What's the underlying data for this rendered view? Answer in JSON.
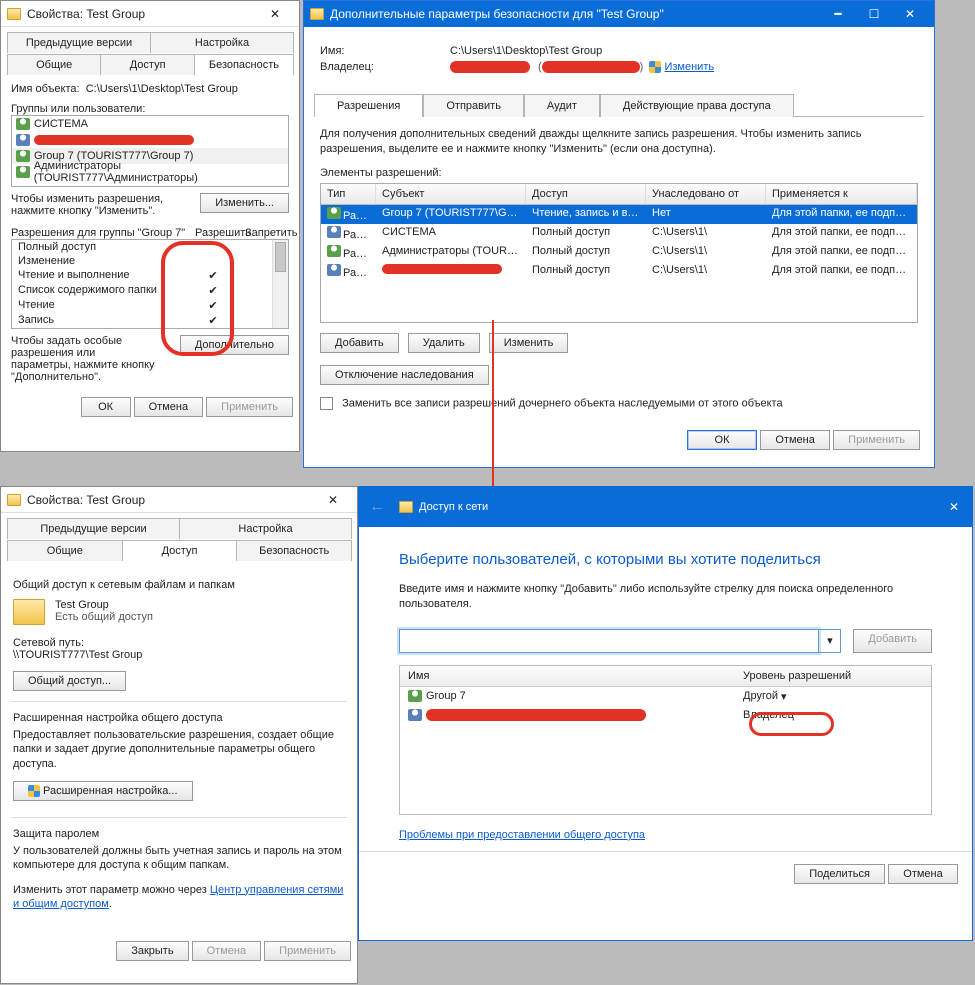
{
  "props1": {
    "title": "Свойства: Test Group",
    "tabs": {
      "prev": "Предыдущие версии",
      "cfg": "Настройка",
      "gen": "Общие",
      "share": "Доступ",
      "sec": "Безопасность"
    },
    "obj_label": "Имя объекта:",
    "obj_value": "C:\\Users\\1\\Desktop\\Test Group",
    "groups_label": "Группы или пользователи:",
    "groups": [
      {
        "name": "СИСТЕМА"
      },
      {
        "name": "redacted"
      },
      {
        "name": "Group 7 (TOURIST777\\Group 7)"
      },
      {
        "name": "Администраторы (TOURIST777\\Администраторы)"
      }
    ],
    "hint1a": "Чтобы изменить разрешения,",
    "hint1b": "нажмите кнопку \"Изменить\".",
    "edit": "Изменить...",
    "perm_for": "Разрешения для группы \"Group 7\"",
    "allow": "Разрешить",
    "deny": "Запретить",
    "perms": [
      {
        "n": "Полный доступ",
        "a": false
      },
      {
        "n": "Изменение",
        "a": false
      },
      {
        "n": "Чтение и выполнение",
        "a": true
      },
      {
        "n": "Список содержимого папки",
        "a": true
      },
      {
        "n": "Чтение",
        "a": true
      },
      {
        "n": "Запись",
        "a": true
      }
    ],
    "hint2a": "Чтобы задать особые разрешения или",
    "hint2b": "параметры, нажмите кнопку",
    "hint2c": "\"Дополнительно\".",
    "adv": "Дополнительно",
    "ok": "ОК",
    "cancel": "Отмена",
    "apply": "Применить"
  },
  "adv": {
    "title": "Дополнительные параметры безопасности для \"Test Group\"",
    "name_k": "Имя:",
    "name_v": "C:\\Users\\1\\Desktop\\Test Group",
    "owner_k": "Владелец:",
    "change": "Изменить",
    "tabs": {
      "perm": "Разрешения",
      "send": "Отправить",
      "audit": "Аудит",
      "eff": "Действующие права доступа"
    },
    "help": "Для получения дополнительных сведений дважды щелкните запись разрешения. Чтобы изменить запись разрешения, выделите ее и нажмите кнопку \"Изменить\" (если она доступна).",
    "elements": "Элементы разрешений:",
    "cols": {
      "type": "Тип",
      "subj": "Субъект",
      "acc": "Доступ",
      "inh": "Унаследовано от",
      "app": "Применяется к"
    },
    "rows": [
      {
        "t": "Разр...",
        "s": "Group 7 (TOURIST777\\Group 7)",
        "a": "Чтение, запись и вып...",
        "i": "Нет",
        "p": "Для этой папки, ее подпапок ..."
      },
      {
        "t": "Разр...",
        "s": "СИСТЕМА",
        "a": "Полный доступ",
        "i": "C:\\Users\\1\\",
        "p": "Для этой папки, ее подпапок ..."
      },
      {
        "t": "Разр...",
        "s": "Администраторы (TOURIST77...",
        "a": "Полный доступ",
        "i": "C:\\Users\\1\\",
        "p": "Для этой папки, ее подпапок ..."
      },
      {
        "t": "Разр...",
        "s": "redacted",
        "a": "Полный доступ",
        "i": "C:\\Users\\1\\",
        "p": "Для этой папки, ее подпапок ..."
      }
    ],
    "add": "Добавить",
    "del": "Удалить",
    "edit": "Изменить",
    "dis": "Отключение наследования",
    "chk": "Заменить все записи разрешений дочернего объекта наследуемыми от этого объекта",
    "ok": "ОК",
    "cancel": "Отмена",
    "apply": "Применить"
  },
  "props2": {
    "title": "Свойства: Test Group",
    "tabs": {
      "prev": "Предыдущие версии",
      "cfg": "Настройка",
      "gen": "Общие",
      "share": "Доступ",
      "sec": "Безопасность"
    },
    "g1_title": "Общий доступ к сетевым файлам и папкам",
    "foldername": "Test Group",
    "shared": "Есть общий доступ",
    "netpath_k": "Сетевой путь:",
    "netpath_v": "\\\\TOURIST777\\Test Group",
    "sharebtn": "Общий доступ...",
    "g2_title": "Расширенная настройка общего доступа",
    "g2_text": "Предоставляет пользовательские разрешения, создает общие папки и задает другие дополнительные параметры общего доступа.",
    "advshare": "Расширенная настройка...",
    "g3_title": "Защита паролем",
    "g3_text": "У пользователей должны быть учетная запись и пароль на этом компьютере для доступа к общим папкам.",
    "g3_text2": "Изменить этот параметр можно через ",
    "g3_link": "Центр управления сетями и общим доступом",
    "close": "Закрыть",
    "cancel": "Отмена",
    "apply": "Применить"
  },
  "net": {
    "breadcrumb": "Доступ к сети",
    "heading": "Выберите пользователей, с которыми вы хотите поделиться",
    "sub": "Введите имя и нажмите кнопку \"Добавить\" либо используйте стрелку для поиска определенного пользователя.",
    "add": "Добавить",
    "col_name": "Имя",
    "col_perm": "Уровень разрешений",
    "rows": [
      {
        "n": "Group 7",
        "p": "Другой"
      },
      {
        "n": "redacted",
        "p": "Владелец"
      }
    ],
    "trouble": "Проблемы при предоставлении общего доступа",
    "share": "Поделиться",
    "cancel": "Отмена"
  }
}
